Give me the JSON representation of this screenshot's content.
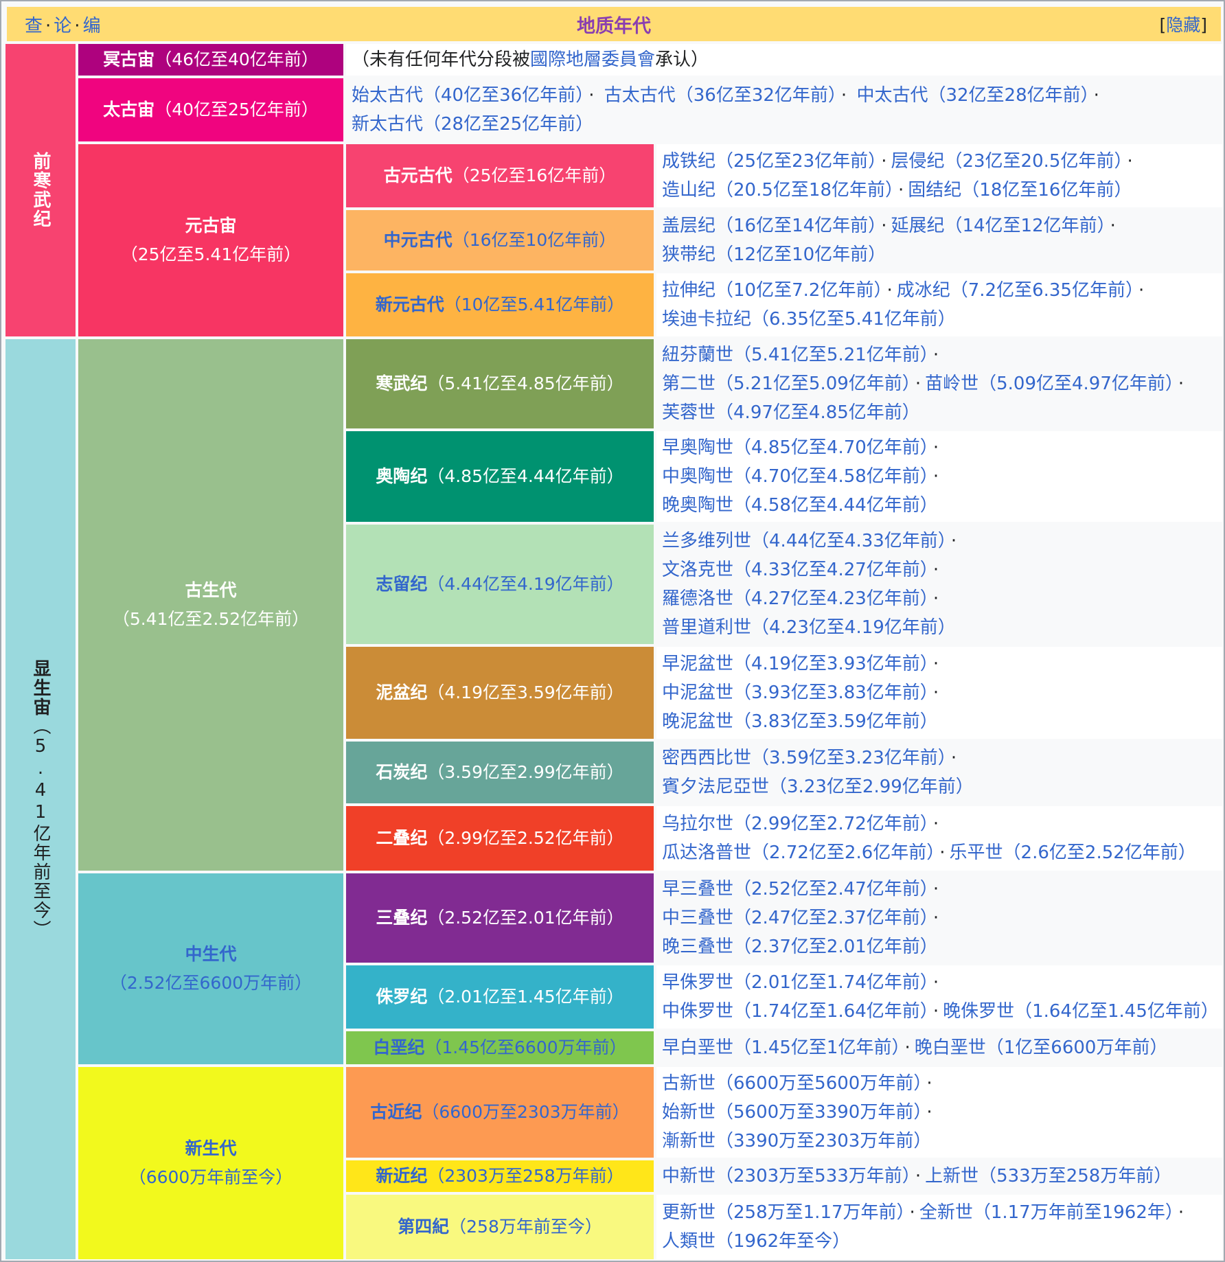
{
  "header": {
    "nav": [
      "查",
      "论",
      "编"
    ],
    "title": "地质年代",
    "hide_label": "隐藏"
  },
  "eons": {
    "precambrian": {
      "name": "前寒武纪",
      "color": "#f74370"
    },
    "phanerozoic": {
      "name": "显生宙",
      "range": "（5.41亿年前至今）",
      "color": "#9ad9dd"
    }
  },
  "hadean": {
    "name": "冥古宙",
    "range": "（46亿至40亿年前）",
    "note_prefix": "（未有任何年代分段被",
    "note_link": "國際地層委員會",
    "note_suffix": "承认）",
    "color": "#ae027e"
  },
  "archean": {
    "name": "太古宙",
    "range": "（40亿至25亿年前）",
    "color": "#f0047f",
    "eras": [
      {
        "name": "始太古代",
        "range": "（40亿至36亿年前）"
      },
      {
        "name": "古太古代",
        "range": "（36亿至32亿年前）"
      },
      {
        "name": "中太古代",
        "range": "（32亿至28亿年前）"
      },
      {
        "name": "新太古代",
        "range": "（28亿至25亿年前）"
      }
    ]
  },
  "proterozoic": {
    "name": "元古宙",
    "range": "（25亿至5.41亿年前）",
    "color": "#f73563",
    "eras": [
      {
        "name": "古元古代",
        "range": "（25亿至16亿年前）",
        "color": "#f74370",
        "periods": [
          {
            "name": "成铁纪",
            "range": "（25亿至23亿年前）"
          },
          {
            "name": "层侵纪",
            "range": "（23亿至20.5亿年前）"
          },
          {
            "name": "造山纪",
            "range": "（20.5亿至18亿年前）"
          },
          {
            "name": "固结纪",
            "range": "（18亿至16亿年前）"
          }
        ]
      },
      {
        "name": "中元古代",
        "range": "（16亿至10亿年前）",
        "color": "#fdb462",
        "periods": [
          {
            "name": "盖层纪",
            "range": "（16亿至14亿年前）"
          },
          {
            "name": "延展纪",
            "range": "（14亿至12亿年前）"
          },
          {
            "name": "狭带纪",
            "range": "（12亿至10亿年前）"
          }
        ]
      },
      {
        "name": "新元古代",
        "range": "（10亿至5.41亿年前）",
        "color": "#feb342",
        "periods": [
          {
            "name": "拉伸纪",
            "range": "（10亿至7.2亿年前）"
          },
          {
            "name": "成冰纪",
            "range": "（7.2亿至6.35亿年前）"
          },
          {
            "name": "埃迪卡拉纪",
            "range": "（6.35亿至5.41亿年前）"
          }
        ]
      }
    ]
  },
  "paleozoic": {
    "name": "古生代",
    "range": "（5.41亿至2.52亿年前）",
    "color": "#99c08d",
    "periods": [
      {
        "name": "寒武纪",
        "range": "（5.41亿至4.85亿年前）",
        "color": "#7fa056",
        "epochs": [
          {
            "name": "紐芬蘭世",
            "range": "（5.41亿至5.21亿年前）"
          },
          {
            "name": "第二世",
            "range": "（5.21亿至5.09亿年前）"
          },
          {
            "name": "苗岭世",
            "range": "（5.09亿至4.97亿年前）"
          },
          {
            "name": "芙蓉世",
            "range": "（4.97亿至4.85亿年前）"
          }
        ]
      },
      {
        "name": "奥陶纪",
        "range": "（4.85亿至4.44亿年前）",
        "color": "#009270",
        "epochs": [
          {
            "name": "早奥陶世",
            "range": "（4.85亿至4.70亿年前）"
          },
          {
            "name": "中奥陶世",
            "range": "（4.70亿至4.58亿年前）"
          },
          {
            "name": "晚奥陶世",
            "range": "（4.58亿至4.44亿年前）"
          }
        ]
      },
      {
        "name": "志留纪",
        "range": "（4.44亿至4.19亿年前）",
        "color": "#b3e1b6",
        "epochs": [
          {
            "name": "兰多维列世",
            "range": "（4.44亿至4.33亿年前）"
          },
          {
            "name": "文洛克世",
            "range": "（4.33亿至4.27亿年前）"
          },
          {
            "name": "羅德洛世",
            "range": "（4.27亿至4.23亿年前）"
          },
          {
            "name": "普里道利世",
            "range": "（4.23亿至4.19亿年前）"
          }
        ]
      },
      {
        "name": "泥盆纪",
        "range": "（4.19亿至3.59亿年前）",
        "color": "#cb8c37",
        "epochs": [
          {
            "name": "早泥盆世",
            "range": "（4.19亿至3.93亿年前）"
          },
          {
            "name": "中泥盆世",
            "range": "（3.93亿至3.83亿年前）"
          },
          {
            "name": "晚泥盆世",
            "range": "（3.83亿至3.59亿年前）"
          }
        ]
      },
      {
        "name": "石炭纪",
        "range": "（3.59亿至2.99亿年前）",
        "color": "#67a599",
        "epochs": [
          {
            "name": "密西西比世",
            "range": "（3.59亿至3.23亿年前）"
          },
          {
            "name": "賓夕法尼亞世",
            "range": "（3.23亿至2.99亿年前）"
          }
        ]
      },
      {
        "name": "二叠纪",
        "range": "（2.99亿至2.52亿年前）",
        "color": "#f04028",
        "epochs": [
          {
            "name": "乌拉尔世",
            "range": "（2.99亿至2.72亿年前）"
          },
          {
            "name": "瓜达洛普世",
            "range": "（2.72亿至2.6亿年前）"
          },
          {
            "name": "乐平世",
            "range": "（2.6亿至2.52亿年前）"
          }
        ]
      }
    ]
  },
  "mesozoic": {
    "name": "中生代",
    "range": "（2.52亿至6600万年前）",
    "color": "#67c5ca",
    "periods": [
      {
        "name": "三叠纪",
        "range": "（2.52亿至2.01亿年前）",
        "color": "#812b92",
        "epochs": [
          {
            "name": "早三叠世",
            "range": "（2.52亿至2.47亿年前）"
          },
          {
            "name": "中三叠世",
            "range": "（2.47亿至2.37亿年前）"
          },
          {
            "name": "晚三叠世",
            "range": "（2.37亿至2.01亿年前）"
          }
        ]
      },
      {
        "name": "侏罗纪",
        "range": "（2.01亿至1.45亿年前）",
        "color": "#34b2c9",
        "epochs": [
          {
            "name": "早侏罗世",
            "range": "（2.01亿至1.74亿年前）"
          },
          {
            "name": "中侏罗世",
            "range": "（1.74亿至1.64亿年前）"
          },
          {
            "name": "晚侏罗世",
            "range": "（1.64亿至1.45亿年前）"
          }
        ]
      },
      {
        "name": "白垩纪",
        "range": "（1.45亿至6600万年前）",
        "color": "#7fc64e",
        "epochs": [
          {
            "name": "早白垩世",
            "range": "（1.45亿至1亿年前）"
          },
          {
            "name": "晚白垩世",
            "range": "（1亿至6600万年前）"
          }
        ]
      }
    ]
  },
  "cenozoic": {
    "name": "新生代",
    "range": "（6600万年前至今）",
    "color": "#f2f91d",
    "periods": [
      {
        "name": "古近纪",
        "range": "（6600万至2303万年前）",
        "color": "#fd9a52",
        "epochs": [
          {
            "name": "古新世",
            "range": "（6600万至5600万年前）"
          },
          {
            "name": "始新世",
            "range": "（5600万至3390万年前）"
          },
          {
            "name": "漸新世",
            "range": "（3390万至2303万年前）"
          }
        ]
      },
      {
        "name": "新近纪",
        "range": "（2303万至258万年前）",
        "color": "#ffe619",
        "epochs": [
          {
            "name": "中新世",
            "range": "（2303万至533万年前）"
          },
          {
            "name": "上新世",
            "range": "（533万至258万年前）"
          }
        ]
      },
      {
        "name": "第四紀",
        "range": "（258万年前至今）",
        "color": "#f9f97f",
        "epochs": [
          {
            "name": "更新世",
            "range": "（258万至1.17万年前）"
          },
          {
            "name": "全新世",
            "range": "（1.17万年前至1962年）"
          },
          {
            "name": "人類世",
            "range": "（1962年至今）"
          }
        ]
      }
    ]
  }
}
